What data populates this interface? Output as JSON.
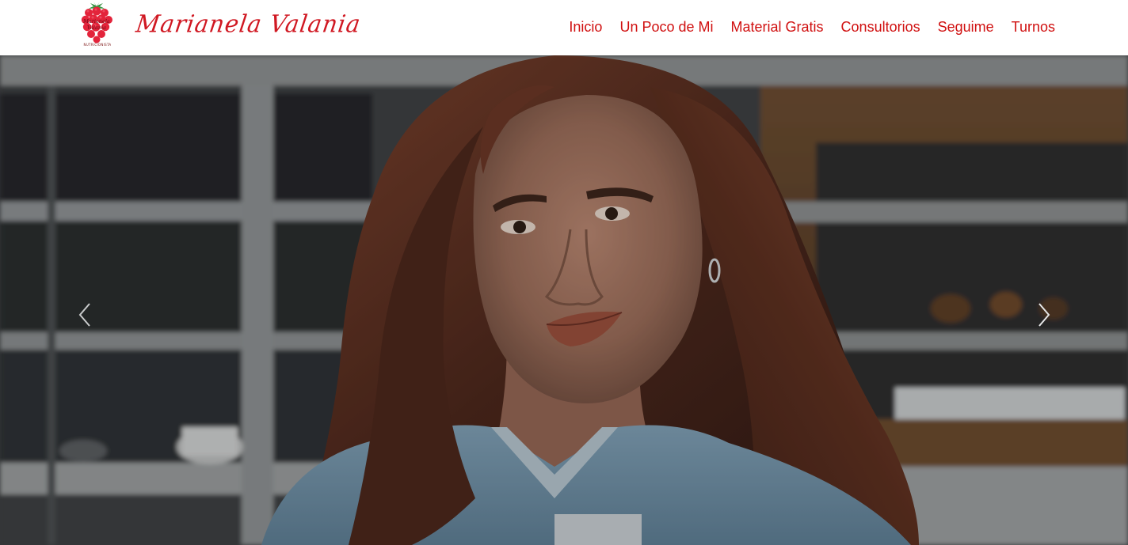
{
  "brand": {
    "name": "Marianela Valania",
    "logo_text": "Marianela Valania",
    "logo_tagline": "NUTRICIONISTA"
  },
  "nav": {
    "items": [
      {
        "label": "Inicio"
      },
      {
        "label": "Un Poco de Mi"
      },
      {
        "label": "Material Gratis"
      },
      {
        "label": "Consultorios"
      },
      {
        "label": "Seguime"
      },
      {
        "label": "Turnos"
      }
    ]
  },
  "carousel": {
    "prev_icon": "chevron-left-icon",
    "next_icon": "chevron-right-icon"
  },
  "colors": {
    "accent": "#d01010",
    "brand_script": "#d01822",
    "header_bg": "#ffffff"
  }
}
